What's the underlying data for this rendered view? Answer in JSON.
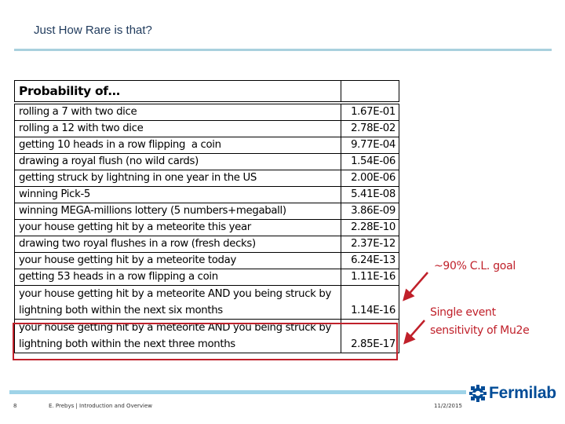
{
  "slide": {
    "title": "Just How Rare is that?"
  },
  "table": {
    "header": {
      "label": "Probability of…",
      "value": ""
    },
    "rows": [
      {
        "label": "rolling a 7 with two dice",
        "value": "1.67E-01"
      },
      {
        "label": "rolling a 12 with two dice",
        "value": "2.78E-02"
      },
      {
        "label": "getting 10 heads in a row flipping  a coin",
        "value": "9.77E-04"
      },
      {
        "label": "drawing a royal flush (no wild cards)",
        "value": "1.54E-06"
      },
      {
        "label": "getting struck by lightning in one year in the US",
        "value": "2.00E-06"
      },
      {
        "label": "winning Pick-5",
        "value": "5.41E-08"
      },
      {
        "label": "winning MEGA-millions lottery (5 numbers+megaball)",
        "value": "3.86E-09"
      },
      {
        "label": "your house getting hit by a meteorite this year",
        "value": "2.28E-10"
      },
      {
        "label": "drawing two royal flushes in a row (fresh decks)",
        "value": "2.37E-12"
      },
      {
        "label": "your house getting hit by a meteorite today",
        "value": "6.24E-13"
      },
      {
        "label": "getting 53 heads in a row flipping a coin",
        "value": "1.11E-16"
      },
      {
        "label": "your house getting hit by a meteorite AND you being struck by lightning both within the next six months",
        "value": "1.14E-16"
      },
      {
        "label": "your house getting hit by a meteorite AND you being struck by lightning both within the next three months",
        "value": "2.85E-17"
      }
    ]
  },
  "annotations": {
    "cl_goal": "~90% C.L. goal",
    "ses_line1": "Single event",
    "ses_line2": "sensitivity of Mu2e",
    "color": "#c0202a"
  },
  "footer": {
    "page_number": "8",
    "author_topic": "E. Prebys | Introduction and Overview",
    "date": "11/2/2015",
    "logo_text": "Fermilab",
    "logo_icon": "fermilab-logo-icon"
  }
}
